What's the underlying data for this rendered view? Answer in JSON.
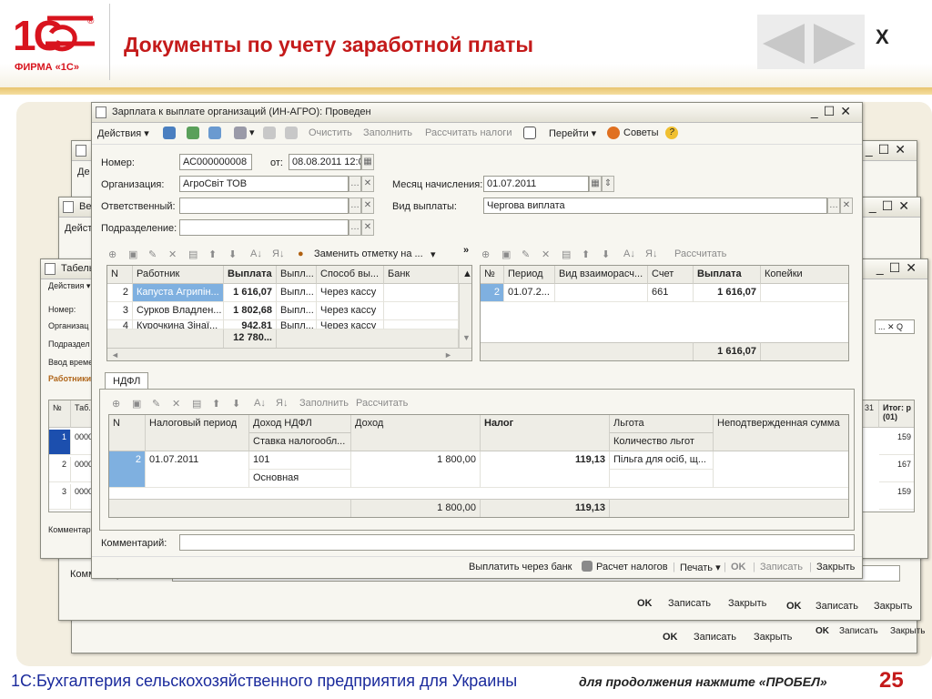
{
  "header": {
    "logo_main": "1С",
    "logo_reg": "®",
    "logo_firm": "ФИРМА «1С»",
    "title": "Документы по учету заработной платы",
    "close": "X"
  },
  "footer": {
    "product": "1С:Бухгалтерия сельскохозяйственного предприятия для Украины",
    "hint": "для продолжения нажмите «ПРОБЕЛ»",
    "page": "25"
  },
  "back1": {
    "title": "Табель",
    "actions": "Действия ▾",
    "labels": [
      "Номер:",
      "Организац",
      "Подраздел",
      "Ввод време",
      "Работники"
    ],
    "row_nums": [
      "1",
      "2",
      "3"
    ],
    "row_vals": [
      "0000",
      "0000",
      "0000"
    ],
    "col_n": "№",
    "col_tab": "Таб.",
    "comment": "Комментари"
  },
  "back2": {
    "title": "Ве",
    "actions": "Дейст",
    "comment": "Комментари"
  },
  "back3": {
    "title": "",
    "actions": "Де",
    "comment": "Комментари"
  },
  "right_back": {
    "col31": "31",
    "col_total": "Итог: р (01)",
    "vals": [
      "159",
      "167",
      "159"
    ],
    "buttons": {
      "ok": "OK",
      "save": "Записать",
      "close": "Закрыть"
    }
  },
  "lower_bars": [
    {
      "ok": "OK",
      "save": "Записать",
      "close": "Закрыть"
    },
    {
      "ok": "OK",
      "save": "Записать",
      "close": "Закрыть"
    },
    {
      "ok": "OK",
      "save": "Записать",
      "close": "Закрыть"
    }
  ],
  "main": {
    "title": "Зарплата к выплате организаций (ИН-АГРО): Проведен",
    "toolbar": {
      "actions": "Действия ▾",
      "clear": "Очистить",
      "fill": "Заполнить",
      "calc_taxes": "Рассчитать налоги",
      "go": "Перейти ▾",
      "tips": "Советы"
    },
    "fields": {
      "number_label": "Номер:",
      "number_value": "АС000000008",
      "date_label": "от:",
      "date_value": "08.08.2011 12:0",
      "org_label": "Организация:",
      "org_value": "АгроСвіт ТОВ",
      "resp_label": "Ответственный:",
      "resp_value": "",
      "dept_label": "Подразделение:",
      "dept_value": "",
      "month_label": "Месяц начисления:",
      "month_value": "01.07.2011",
      "paytype_label": "Вид выплаты:",
      "paytype_value": "Чергова виплата"
    },
    "left_grid": {
      "toolbar_replace": "Заменить отметку на ...",
      "headers": [
        "N",
        "Работник",
        "Выплата",
        "Выпл...",
        "Способ вы...",
        "Банк"
      ],
      "rows": [
        [
          "2",
          "Капуста Агрипін...",
          "1 616,07",
          "Выпл...",
          "Через кассу",
          ""
        ],
        [
          "3",
          "Сурков Владлен...",
          "1 802,68",
          "Выпл...",
          "Через кассу",
          ""
        ],
        [
          "4",
          "Курочкина Зінаї...",
          "942,81",
          "Выпл...",
          "Через кассу",
          ""
        ]
      ],
      "total": "12 780..."
    },
    "right_grid": {
      "toolbar_calc": "Рассчитать",
      "headers": [
        "№",
        "Период",
        "Вид взаиморасч...",
        "Счет",
        "Выплата",
        "Копейки"
      ],
      "rows": [
        [
          "2",
          "01.07.2...",
          "",
          "661",
          "1 616,07",
          ""
        ]
      ],
      "total": "1 616,07"
    },
    "ndfl": {
      "tab": "НДФЛ",
      "toolbar_fill": "Заполнить",
      "toolbar_calc": "Рассчитать",
      "headers": {
        "n": "N",
        "period": "Налоговый период",
        "income_ndfl": "Доход НДФЛ",
        "rate": "Ставка налогообл...",
        "income": "Доход",
        "tax": "Налог",
        "benefit": "Льгота",
        "benefit_count": "Количество льгот",
        "unconfirmed": "Неподтвержденная сумма"
      },
      "row": {
        "n": "2",
        "period": "01.07.2011",
        "code": "101",
        "rate": "Основная",
        "income": "1 800,00",
        "tax": "119,13",
        "benefit": "Пільга для осіб, щ..."
      },
      "total_income": "1 800,00",
      "total_tax": "119,13"
    },
    "comment_label": "Комментарий:",
    "bottom": {
      "bank": "Выплатить через банк",
      "tax_calc": "Расчет налогов",
      "print": "Печать ▾",
      "ok": "OK",
      "save": "Записать",
      "close": "Закрыть"
    }
  }
}
